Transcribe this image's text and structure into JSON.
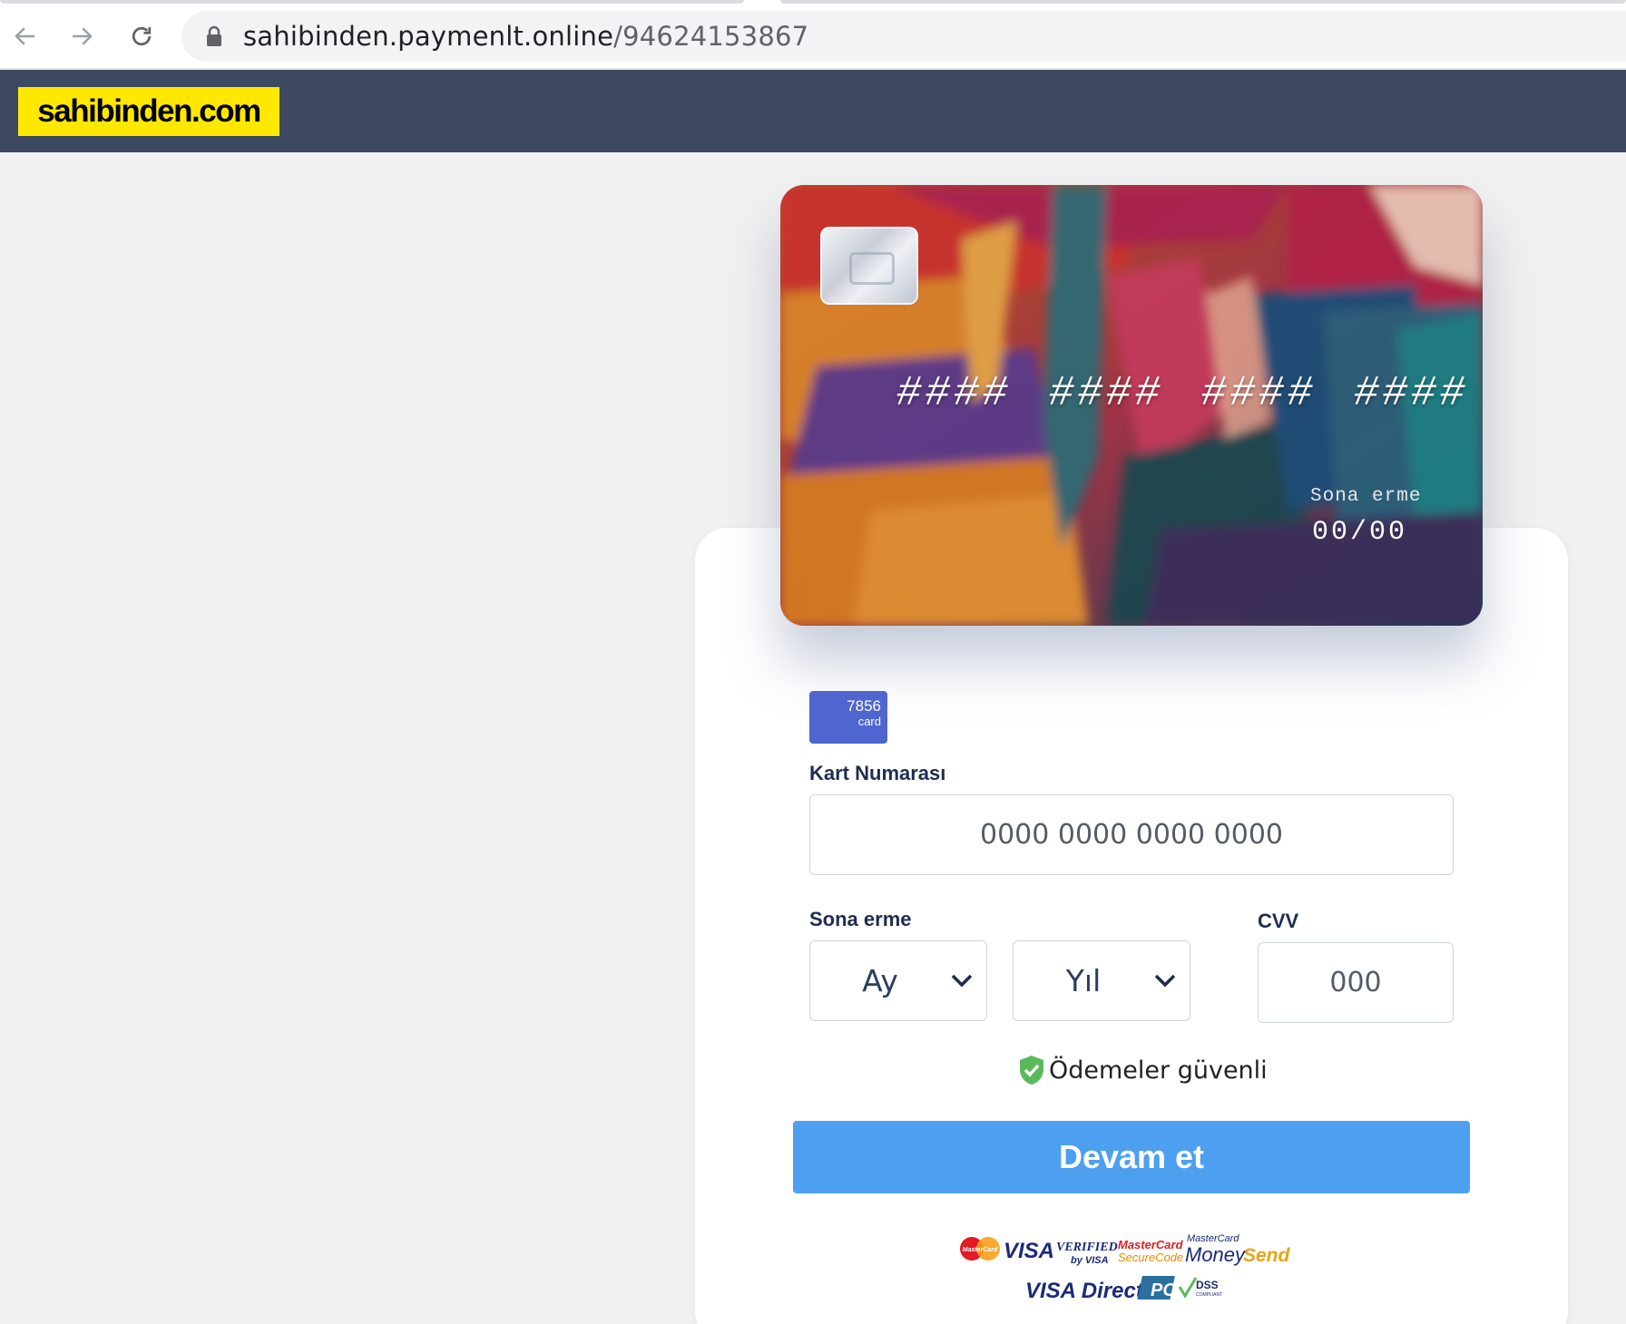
{
  "browser": {
    "url_host": "sahibinden.paymenlt.online",
    "url_path": "/94624153867"
  },
  "site": {
    "logo_text": "sahibinden.com",
    "logo_bg": "#ffe800",
    "header_bg": "#3c4961"
  },
  "card_preview": {
    "number_mask": "#### #### #### ####",
    "expiry_label": "Sona erme",
    "expiry_value": "00/00"
  },
  "form": {
    "card_type_badge": {
      "number": "7856",
      "label": "card"
    },
    "card_number": {
      "label": "Kart Numarası",
      "placeholder": "0000 0000 0000 0000"
    },
    "expiry": {
      "label": "Sona erme",
      "month_selected": "Ay",
      "year_selected": "Yıl"
    },
    "cvv": {
      "label": "CVV",
      "placeholder": "000"
    },
    "secure_text": "Ödemeler güvenli",
    "submit_label": "Devam et",
    "submit_color": "#4d9ff0"
  },
  "payment_logos": {
    "items": [
      "MasterCard",
      "VISA",
      "Verified by VISA",
      "MasterCard SecureCode",
      "MasterCard MoneySend",
      "VISA Direct",
      "PCI DSS Compliant"
    ]
  }
}
